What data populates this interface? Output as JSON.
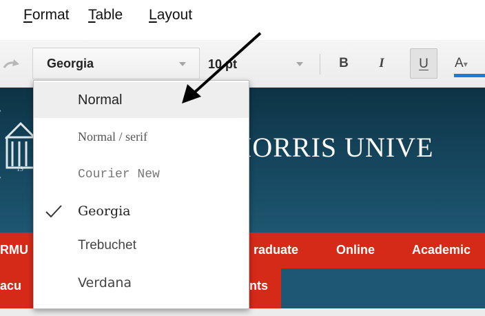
{
  "menubar": {
    "items": [
      {
        "accel": "F",
        "rest": "ormat"
      },
      {
        "accel": "T",
        "rest": "able"
      },
      {
        "accel": "L",
        "rest": "ayout"
      }
    ]
  },
  "toolbar": {
    "font_selected": "Georgia",
    "font_size": "10 pt",
    "bold_label": "B",
    "italic_label": "I",
    "underline_label": "U",
    "text_color_label": "A",
    "text_color_caret": "▾",
    "text_color_value": "#1e7bd4"
  },
  "font_menu": {
    "items": [
      {
        "label": "Normal",
        "highlighted": true,
        "checked": false
      },
      {
        "label": "Normal / serif",
        "highlighted": false,
        "checked": false
      },
      {
        "label": "Courier New",
        "highlighted": false,
        "checked": false
      },
      {
        "label": "Georgia",
        "highlighted": false,
        "checked": true
      },
      {
        "label": "Trebuchet",
        "highlighted": false,
        "checked": false
      },
      {
        "label": "Verdana",
        "highlighted": false,
        "checked": false
      }
    ]
  },
  "website": {
    "title": "IORRIS UNIVE",
    "logo_year": "19",
    "nav": [
      "RMU",
      "raduate",
      "Online",
      "Academic"
    ],
    "subnav": [
      "acu",
      "nts"
    ],
    "colors": {
      "header": "#16475f",
      "nav": "#d62a19",
      "subnav": "#1c5873"
    }
  },
  "annotation": {
    "type": "arrow",
    "color": "#000000"
  }
}
